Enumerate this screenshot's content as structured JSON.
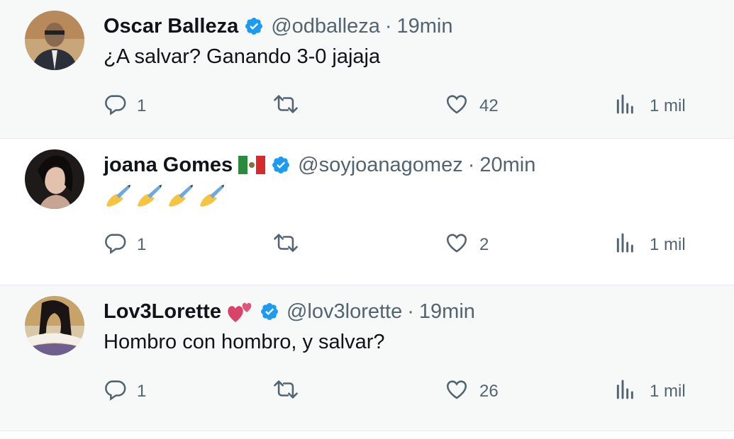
{
  "tweets": [
    {
      "name": "Oscar Balleza",
      "name_emoji": "",
      "handle": "@odballeza",
      "time": "19min",
      "text": "¿A salvar? Ganando 3-0 jajaja",
      "replies": "1",
      "retweets": "",
      "likes": "42",
      "views": "1 mil"
    },
    {
      "name": "joana Gomes",
      "name_emoji": "mexico-flag",
      "handle": "@soyjoanagomez",
      "time": "20min",
      "text": "✍✍✍✍",
      "replies": "1",
      "retweets": "",
      "likes": "2",
      "views": "1 mil"
    },
    {
      "name": "Lov3Lorette",
      "name_emoji": "two-hearts",
      "handle": "@lov3lorette",
      "time": "19min",
      "text": "Hombro con hombro, y salvar?",
      "replies": "1",
      "retweets": "",
      "likes": "26",
      "views": "1 mil"
    }
  ],
  "separator": "·",
  "colors": {
    "verified": "#1d9bf0",
    "muted": "#536471",
    "text": "#0f1419",
    "highlight_bg": "#f7f9f9"
  },
  "icons": {
    "reply": "reply-icon",
    "retweet": "retweet-icon",
    "like": "heart-icon",
    "views": "views-icon",
    "verified": "verified-badge-icon"
  }
}
